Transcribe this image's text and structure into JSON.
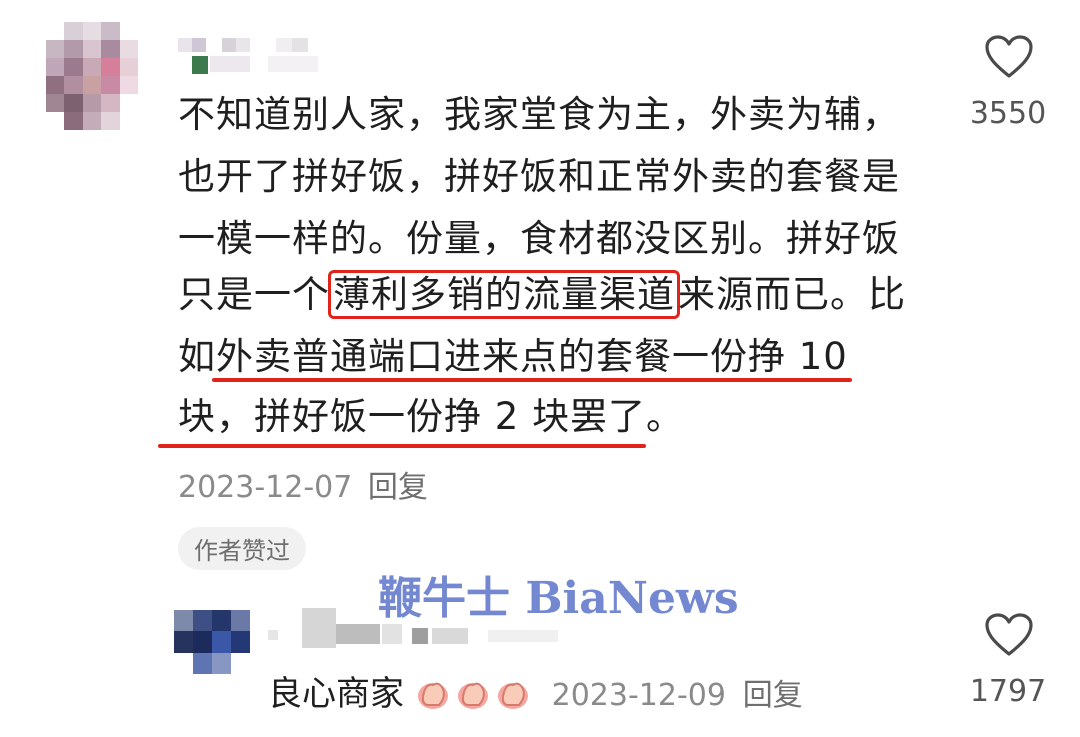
{
  "comment": {
    "lines": {
      "l1": "不知道别人家，我家堂食为主，外卖为辅，",
      "l2": "也开了拼好饭，拼好饭和正常外卖的套餐是",
      "l3": "一模一样的。份量，食材都没区别。拼好饭",
      "l4_pre": "只是一个",
      "l4_box": "薄利多销的流量渠道",
      "l4_post": "来源而已。比",
      "l5": "如外卖普通端口进来点的套餐一份挣 10",
      "l6": "块，拼好饭一份挣 2 块罢了。"
    },
    "date": "2023-12-07",
    "reply_label": "回复",
    "like_count": "3550",
    "tag": "作者赞过"
  },
  "reply": {
    "text": "良心商家",
    "date": "2023-12-09",
    "reply_label": "回复",
    "like_count": "1797",
    "emoji_icon": "thumbs-up-emoji",
    "emoji_count": 3
  },
  "watermark": "鞭牛士 BiaNews",
  "colors": {
    "highlight_red": "#e0241b",
    "meta_gray": "#8a8a8a",
    "watermark_blue": "#5b74c9"
  },
  "icons": {
    "like": "heart-outline-icon"
  }
}
